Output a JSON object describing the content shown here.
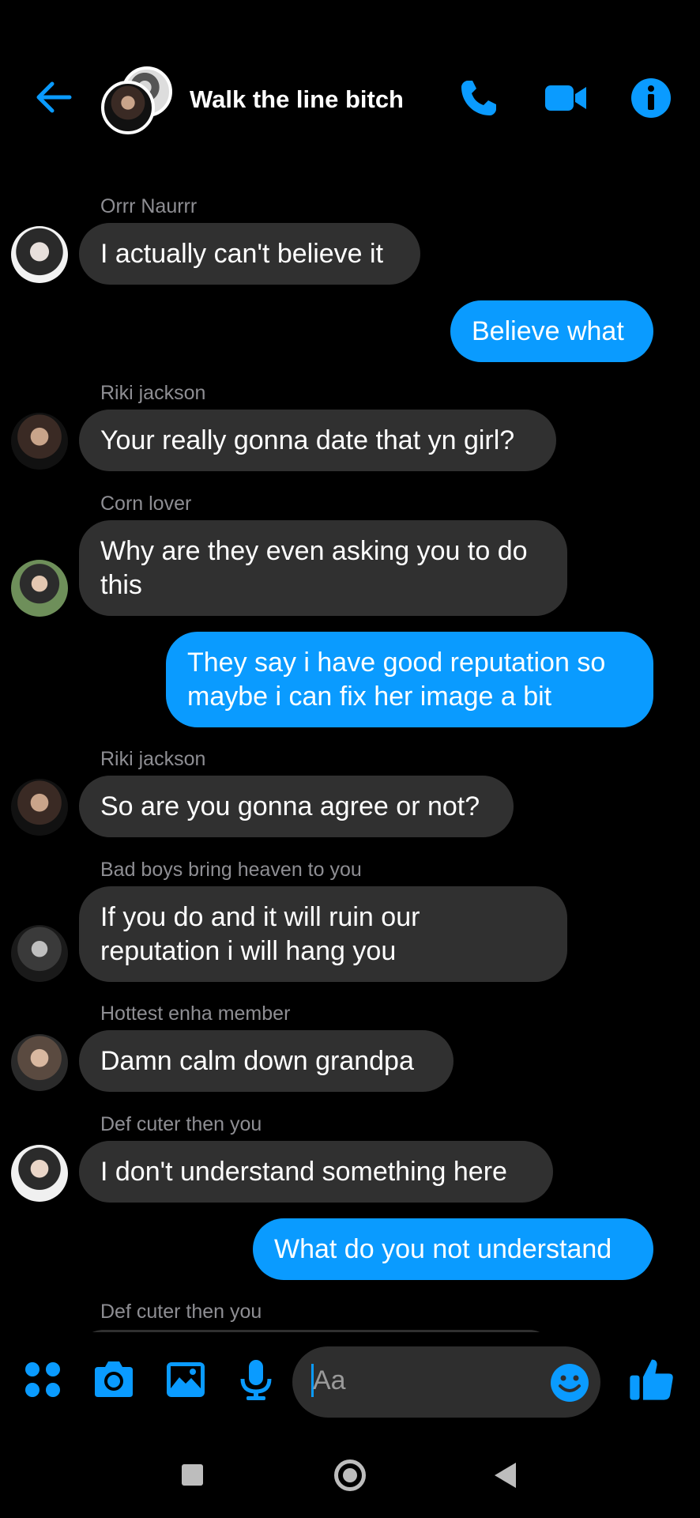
{
  "header": {
    "title": "Walk the line bitch",
    "accent": "#0a9bff"
  },
  "messages": [
    {
      "sender": "Orrr Naurrr",
      "text": "I actually can't believe it",
      "dir": "in",
      "avatar": "avatar-orrr"
    },
    {
      "text": "Believe what",
      "dir": "out"
    },
    {
      "sender": "Riki jackson",
      "text": "Your really gonna date that yn girl?",
      "dir": "in",
      "avatar": "avatar-riki"
    },
    {
      "sender": "Corn lover",
      "text": "Why are they even asking you to do\nthis",
      "dir": "in",
      "avatar": "avatar-corn"
    },
    {
      "text": "They say i have good reputation so\nmaybe i can fix her image a bit",
      "dir": "out"
    },
    {
      "sender": "Riki jackson",
      "text": "So are you gonna agree or not?",
      "dir": "in",
      "avatar": "avatar-riki"
    },
    {
      "sender": "Bad boys bring heaven to you",
      "text": "If you do and it will ruin our\nreputation i will hang you",
      "dir": "in",
      "avatar": "avatar-badboys"
    },
    {
      "sender": "Hottest enha member",
      "text": "Damn calm down grandpa",
      "dir": "in",
      "avatar": "avatar-hottest"
    },
    {
      "sender": "Def cuter then you",
      "text": "I don't understand something here",
      "dir": "in",
      "avatar": "avatar-def"
    },
    {
      "text": "What do you not understand",
      "dir": "out"
    },
    {
      "sender": "Def cuter then you",
      "text": "",
      "dir": "in-partial"
    }
  ],
  "composer": {
    "placeholder": "Aa"
  },
  "colors": {
    "incoming_bubble": "#303030",
    "outgoing_bubble": "#0a9bff",
    "background": "#000000",
    "sender_name": "#8e8e93"
  }
}
